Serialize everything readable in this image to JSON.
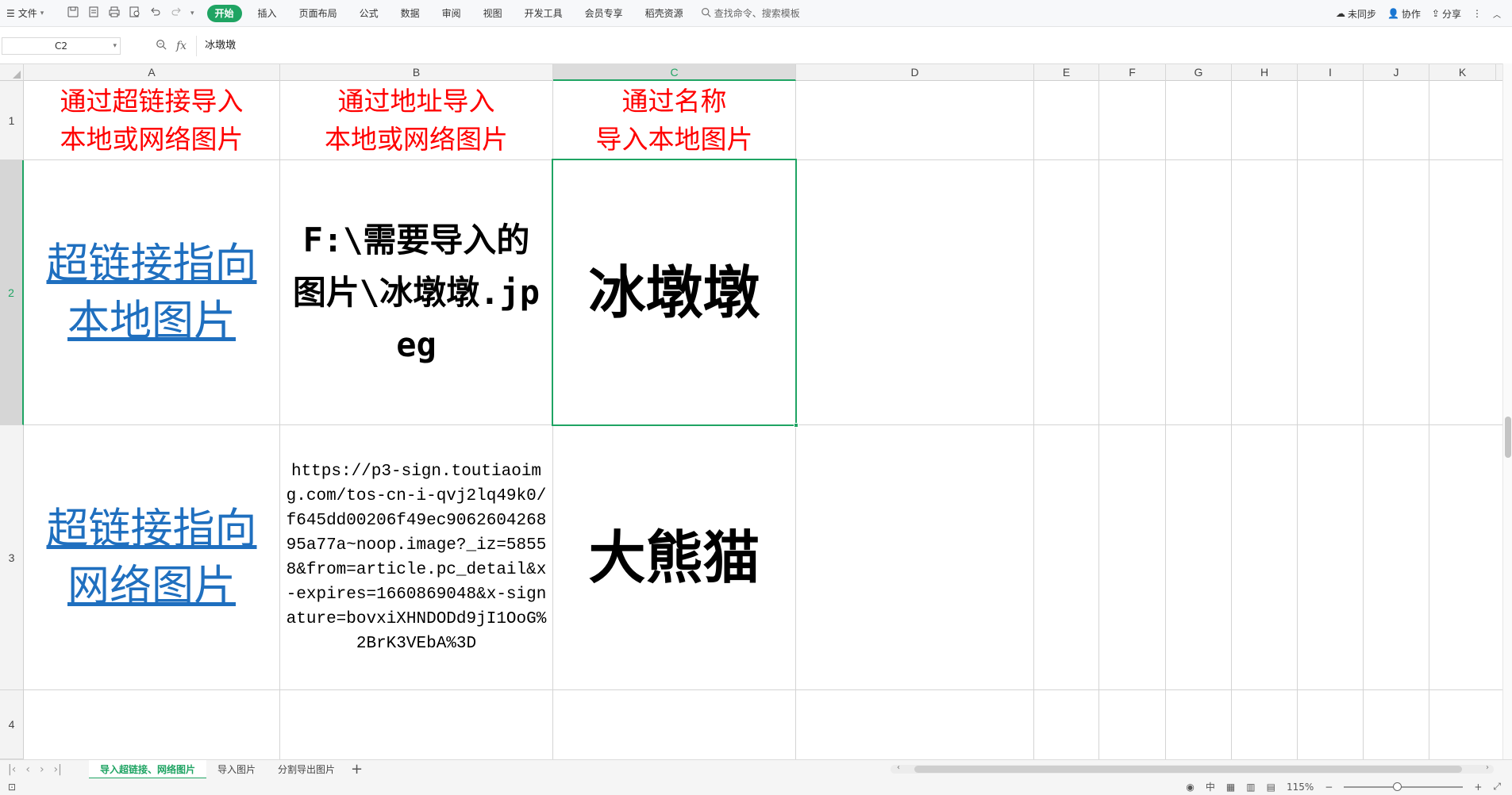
{
  "menubar": {
    "file_label": "文件",
    "tabs": [
      {
        "label": "开始",
        "active": true
      },
      {
        "label": "插入"
      },
      {
        "label": "页面布局"
      },
      {
        "label": "公式"
      },
      {
        "label": "数据"
      },
      {
        "label": "审阅"
      },
      {
        "label": "视图"
      },
      {
        "label": "开发工具"
      },
      {
        "label": "会员专享"
      },
      {
        "label": "稻壳资源"
      }
    ],
    "search_placeholder": "查找命令、搜索模板",
    "sync_label": "未同步",
    "collab_label": "协作",
    "share_label": "分享"
  },
  "formula": {
    "cell_ref": "C2",
    "content": "冰墩墩"
  },
  "columns": [
    "A",
    "B",
    "C",
    "D",
    "E",
    "F",
    "G",
    "H",
    "I",
    "J",
    "K"
  ],
  "rows": [
    "1",
    "2",
    "3",
    "4"
  ],
  "cells": {
    "a1_line1": "通过超链接导入",
    "a1_line2": "本地或网络图片",
    "b1_line1": "通过地址导入",
    "b1_line2": "本地或网络图片",
    "c1_line1": "通过名称",
    "c1_line2": "导入本地图片",
    "a2_line1": "超链接指向",
    "a2_line2": "本地图片",
    "b2": "F:\\需要导入的图片\\冰墩墩.jpeg",
    "c2": "冰墩墩",
    "a3_line1": "超链接指向",
    "a3_line2": "网络图片",
    "b3": "https://p3-sign.toutiaoimg.com/tos-cn-i-qvj2lq49k0/f645dd00206f49ec906260426895a77a~noop.image?_iz=58558&from=article.pc_detail&x-expires=1660869048&x-signature=bovxiXHNDODd9jI1OoG%2BrK3VEbA%3D",
    "c3": "大熊猫"
  },
  "sheets": [
    {
      "label": "导入超链接、网络图片",
      "active": true
    },
    {
      "label": "导入图片"
    },
    {
      "label": "分割导出图片"
    }
  ],
  "status": {
    "zoom": "115%"
  },
  "colors": {
    "accent": "#1fa463",
    "header_text": "#ff0000",
    "link_text": "#1f6fbf"
  }
}
